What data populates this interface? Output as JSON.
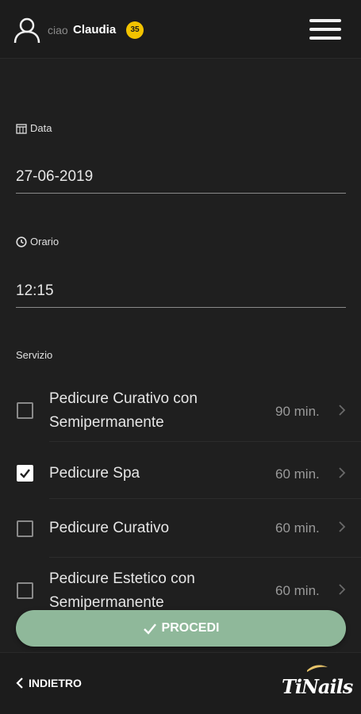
{
  "header": {
    "greeting": "ciao",
    "username": "Claudia",
    "points": "35"
  },
  "form": {
    "date_label": "Data",
    "date_value": "27-06-2019",
    "time_label": "Orario",
    "time_value": "12:15",
    "service_label": "Servizio"
  },
  "services": [
    {
      "name": "Pedicure Curativo con Semipermanente",
      "duration": "90 min.",
      "checked": false
    },
    {
      "name": "Pedicure Spa",
      "duration": "60 min.",
      "checked": true
    },
    {
      "name": "Pedicure Curativo",
      "duration": "60 min.",
      "checked": false
    },
    {
      "name": "Pedicure Estetico con Semipermanente",
      "duration": "60 min.",
      "checked": false
    }
  ],
  "actions": {
    "proceed_label": "PROCEDI",
    "back_label": "INDIETRO"
  },
  "brand": {
    "logo_text": "TiNails"
  },
  "colors": {
    "accent_green": "#8fb89a",
    "badge_yellow": "#f2c300",
    "background": "#1f1f1f"
  }
}
